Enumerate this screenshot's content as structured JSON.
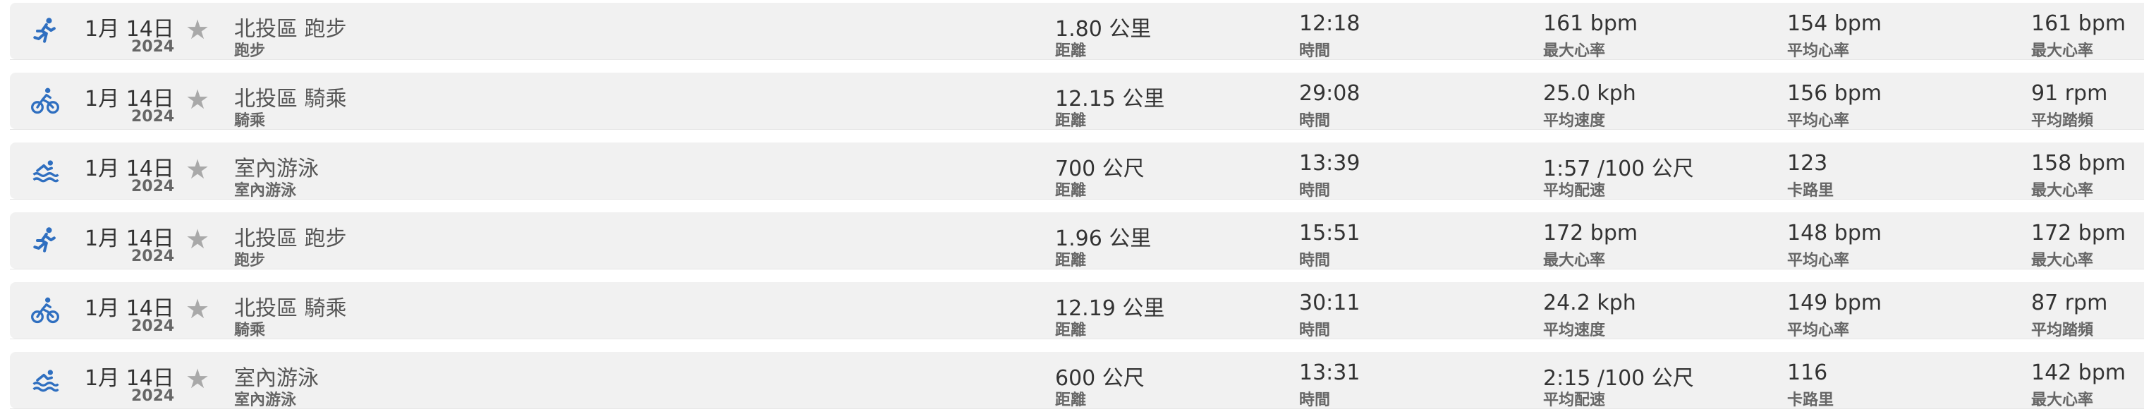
{
  "accent_color": "#2f6fc0",
  "star_color": "#a9a9a9",
  "activities": [
    {
      "icon": "running-icon",
      "date": "1月 14日",
      "year": "2024",
      "name": "北投區 跑步",
      "type": "跑步",
      "stats": [
        {
          "value": "1.80 公里",
          "label": "距離"
        },
        {
          "value": "12:18",
          "label": "時間"
        },
        {
          "value": "161 bpm",
          "label": "最大心率"
        },
        {
          "value": "154 bpm",
          "label": "平均心率"
        },
        {
          "value": "161 bpm",
          "label": "最大心率"
        }
      ]
    },
    {
      "icon": "cycling-icon",
      "date": "1月 14日",
      "year": "2024",
      "name": "北投區 騎乘",
      "type": "騎乘",
      "stats": [
        {
          "value": "12.15 公里",
          "label": "距離"
        },
        {
          "value": "29:08",
          "label": "時間"
        },
        {
          "value": "25.0 kph",
          "label": "平均速度"
        },
        {
          "value": "156 bpm",
          "label": "平均心率"
        },
        {
          "value": "91 rpm",
          "label": "平均踏頻"
        }
      ]
    },
    {
      "icon": "swimming-icon",
      "date": "1月 14日",
      "year": "2024",
      "name": "室內游泳",
      "type": "室內游泳",
      "stats": [
        {
          "value": "700 公尺",
          "label": "距離"
        },
        {
          "value": "13:39",
          "label": "時間"
        },
        {
          "value": "1:57 /100 公尺",
          "label": "平均配速"
        },
        {
          "value": "123",
          "label": "卡路里"
        },
        {
          "value": "158 bpm",
          "label": "最大心率"
        }
      ]
    },
    {
      "icon": "running-icon",
      "date": "1月 14日",
      "year": "2024",
      "name": "北投區 跑步",
      "type": "跑步",
      "stats": [
        {
          "value": "1.96 公里",
          "label": "距離"
        },
        {
          "value": "15:51",
          "label": "時間"
        },
        {
          "value": "172 bpm",
          "label": "最大心率"
        },
        {
          "value": "148 bpm",
          "label": "平均心率"
        },
        {
          "value": "172 bpm",
          "label": "最大心率"
        }
      ]
    },
    {
      "icon": "cycling-icon",
      "date": "1月 14日",
      "year": "2024",
      "name": "北投區 騎乘",
      "type": "騎乘",
      "stats": [
        {
          "value": "12.19 公里",
          "label": "距離"
        },
        {
          "value": "30:11",
          "label": "時間"
        },
        {
          "value": "24.2 kph",
          "label": "平均速度"
        },
        {
          "value": "149 bpm",
          "label": "平均心率"
        },
        {
          "value": "87 rpm",
          "label": "平均踏頻"
        }
      ]
    },
    {
      "icon": "swimming-icon",
      "date": "1月 14日",
      "year": "2024",
      "name": "室內游泳",
      "type": "室內游泳",
      "stats": [
        {
          "value": "600 公尺",
          "label": "距離"
        },
        {
          "value": "13:31",
          "label": "時間"
        },
        {
          "value": "2:15 /100 公尺",
          "label": "平均配速"
        },
        {
          "value": "116",
          "label": "卡路里"
        },
        {
          "value": "142 bpm",
          "label": "最大心率"
        }
      ]
    }
  ]
}
